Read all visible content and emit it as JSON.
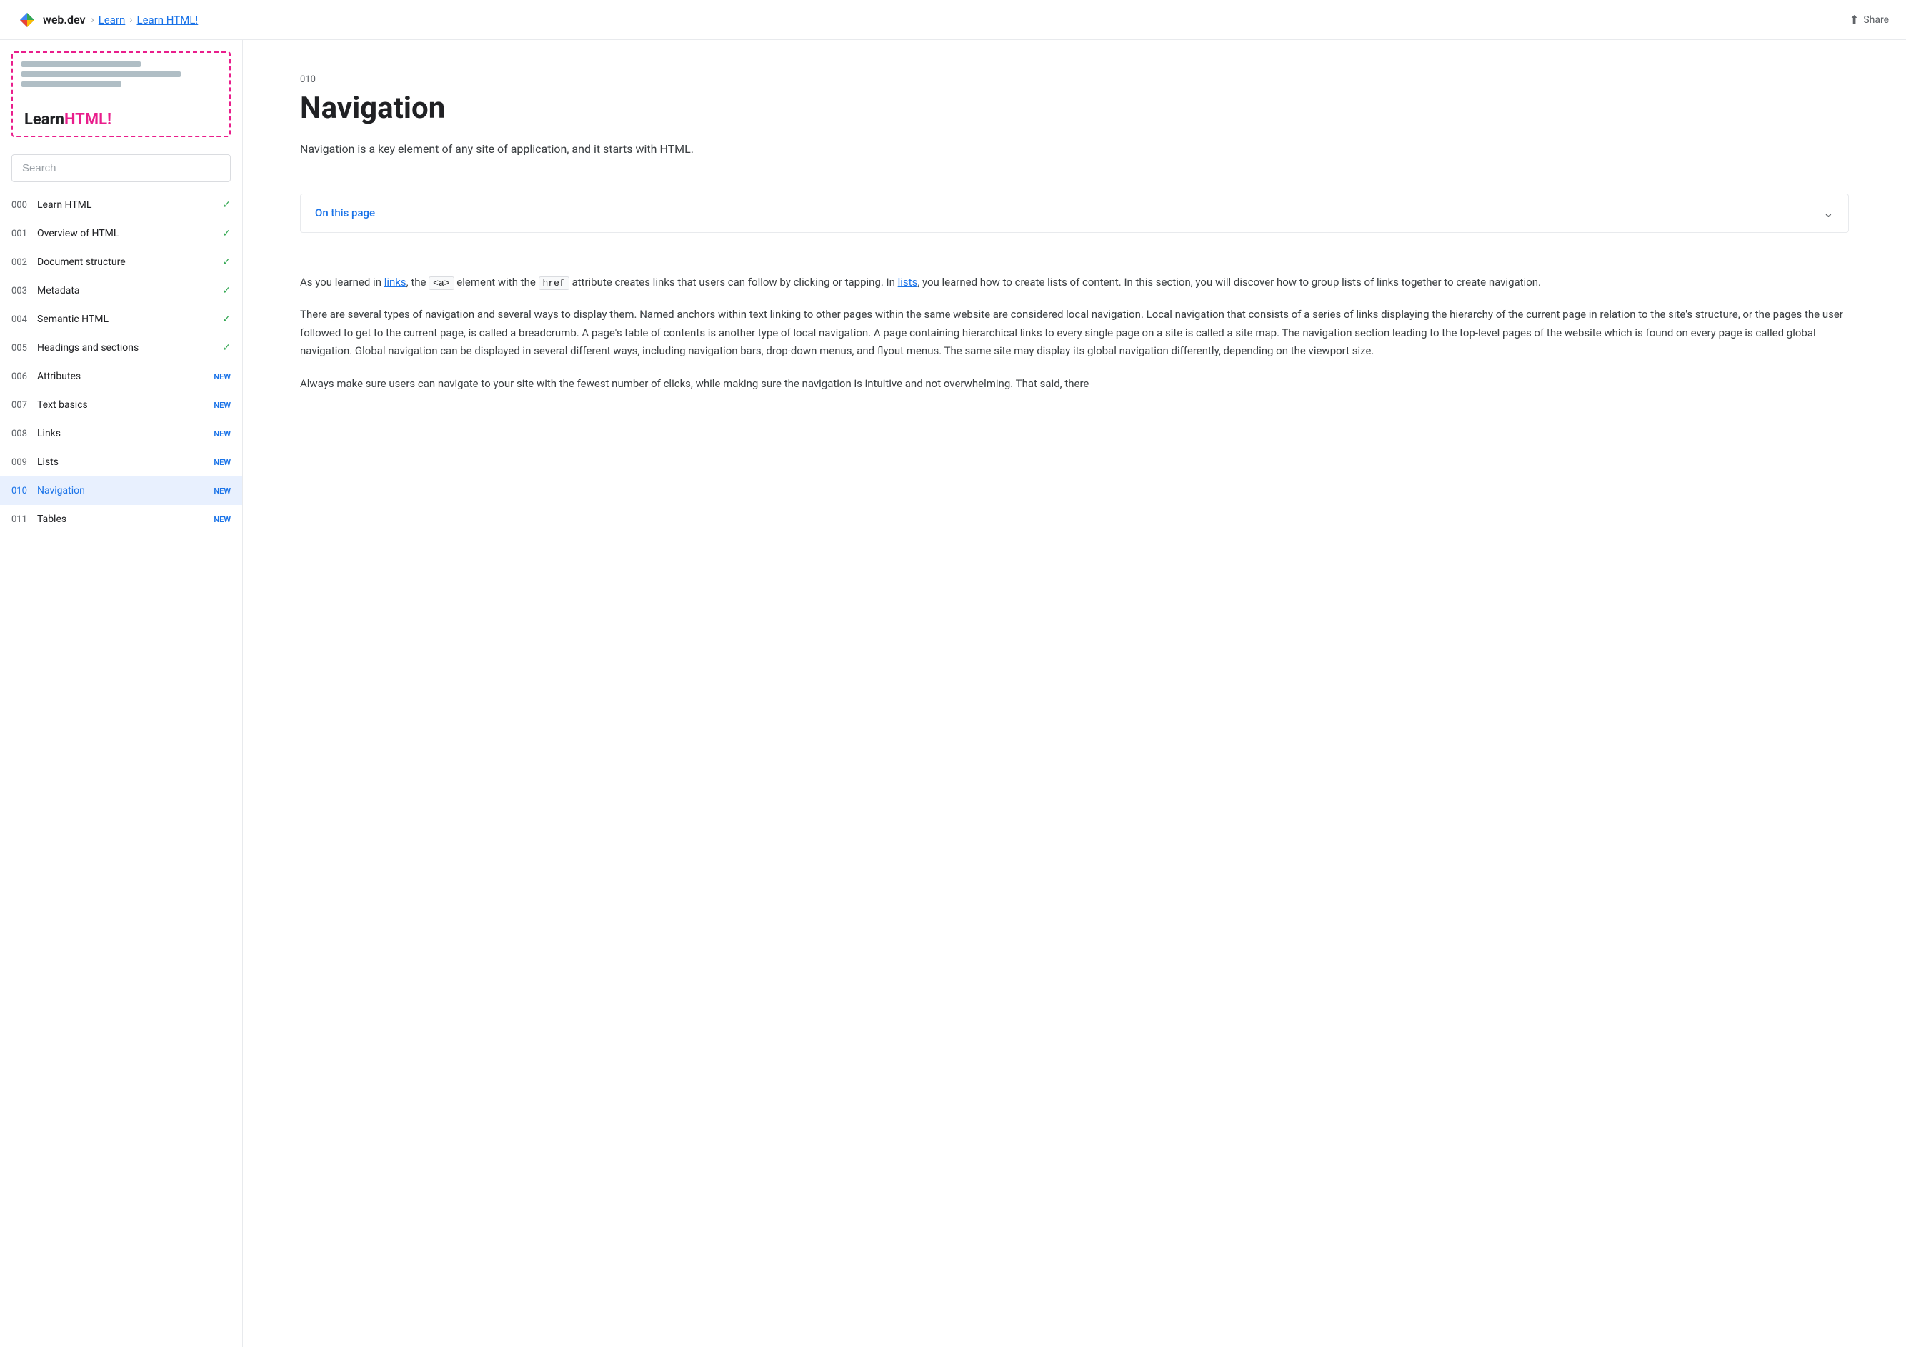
{
  "header": {
    "logo_text": "web.dev",
    "breadcrumbs": [
      "Learn",
      "Learn HTML!"
    ],
    "share_label": "Share"
  },
  "sidebar": {
    "hero_title_learn": "Learn",
    "hero_title_html": "HTML",
    "hero_title_excl": "!",
    "search_placeholder": "Search",
    "nav_items": [
      {
        "num": "000",
        "label": "Learn HTML",
        "badge": "",
        "check": true
      },
      {
        "num": "001",
        "label": "Overview of HTML",
        "badge": "",
        "check": true
      },
      {
        "num": "002",
        "label": "Document structure",
        "badge": "",
        "check": true
      },
      {
        "num": "003",
        "label": "Metadata",
        "badge": "",
        "check": true
      },
      {
        "num": "004",
        "label": "Semantic HTML",
        "badge": "",
        "check": true
      },
      {
        "num": "005",
        "label": "Headings and sections",
        "badge": "",
        "check": true
      },
      {
        "num": "006",
        "label": "Attributes",
        "badge": "NEW",
        "check": false
      },
      {
        "num": "007",
        "label": "Text basics",
        "badge": "NEW",
        "check": false
      },
      {
        "num": "008",
        "label": "Links",
        "badge": "NEW",
        "check": false
      },
      {
        "num": "009",
        "label": "Lists",
        "badge": "NEW",
        "check": false
      },
      {
        "num": "010",
        "label": "Navigation",
        "badge": "NEW",
        "check": false,
        "active": true
      },
      {
        "num": "011",
        "label": "Tables",
        "badge": "NEW",
        "check": false
      }
    ]
  },
  "content": {
    "num": "010",
    "title": "Navigation",
    "subtitle": "Navigation is a key element of any site of application, and it starts with HTML.",
    "on_this_page_label": "On this page",
    "paragraph1": "As you learned in links, the <a> element with the href attribute creates links that users can follow by clicking or tapping. In lists, you learned how to create lists of content. In this section, you will discover how to group lists of links together to create navigation.",
    "paragraph2": "There are several types of navigation and several ways to display them. Named anchors within text linking to other pages within the same website are considered local navigation. Local navigation that consists of a series of links displaying the hierarchy of the current page in relation to the site's structure, or the pages the user followed to get to the current page, is called a breadcrumb. A page's table of contents is another type of local navigation. A page containing hierarchical links to every single page on a site is called a site map. The navigation section leading to the top-level pages of the website which is found on every page is called global navigation. Global navigation can be displayed in several different ways, including navigation bars, drop-down menus, and flyout menus. The same site may display its global navigation differently, depending on the viewport size.",
    "paragraph3": "Always make sure users can navigate to your site with the fewest number of clicks, while making sure the navigation is intuitive and not overwhelming. That said, there"
  }
}
